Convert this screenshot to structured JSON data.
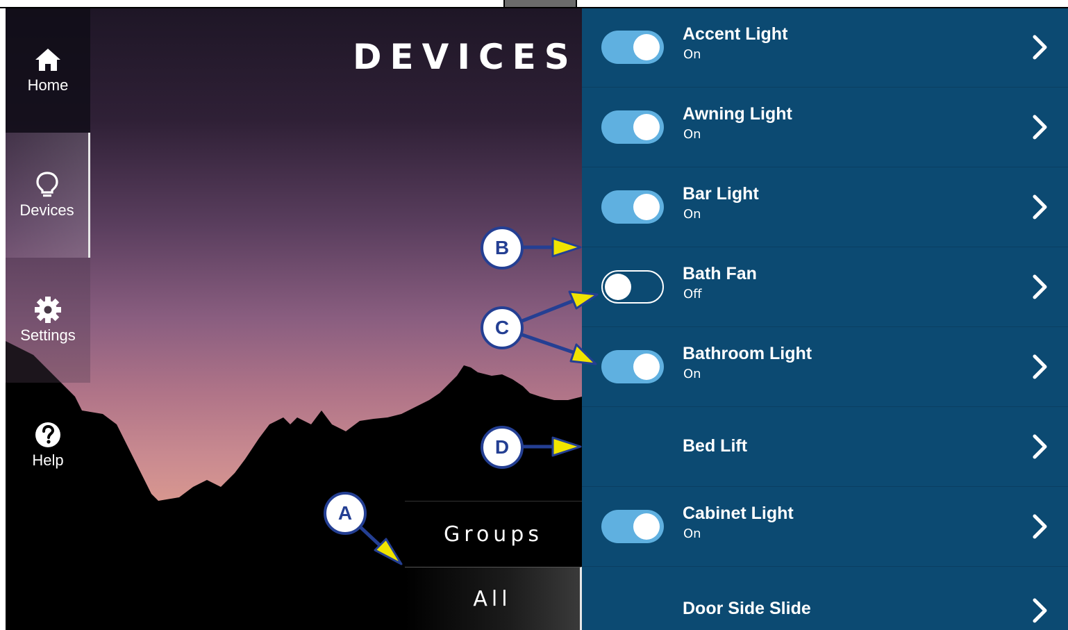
{
  "page_title": "DEVICES",
  "nav": {
    "home_label": "Home",
    "devices_label": "Devices",
    "settings_label": "Settings",
    "help_label": "Help"
  },
  "tabs": {
    "groups_label": "Groups",
    "all_label": "All"
  },
  "devices": [
    {
      "name": "Accent Light",
      "status": "On",
      "toggle": "on"
    },
    {
      "name": "Awning Light",
      "status": "On",
      "toggle": "on"
    },
    {
      "name": "Bar Light",
      "status": "On",
      "toggle": "on"
    },
    {
      "name": "Bath Fan",
      "status": "Off",
      "toggle": "off"
    },
    {
      "name": "Bathroom Light",
      "status": "On",
      "toggle": "on"
    },
    {
      "name": "Bed Lift",
      "status": "",
      "toggle": "none"
    },
    {
      "name": "Cabinet Light",
      "status": "On",
      "toggle": "on"
    },
    {
      "name": "Door Side Slide",
      "status": "",
      "toggle": "none"
    }
  ],
  "callouts": {
    "a": "A",
    "b": "B",
    "c": "C",
    "d": "D"
  },
  "colors": {
    "list_bg": "#0c4a72",
    "toggle_on": "#5fb0e0",
    "callout_ring": "#243f93",
    "arrow_fill": "#f0e400"
  },
  "icons": [
    "home-icon",
    "lightbulb-icon",
    "gear-icon",
    "help-icon",
    "chevron-right-icon"
  ]
}
